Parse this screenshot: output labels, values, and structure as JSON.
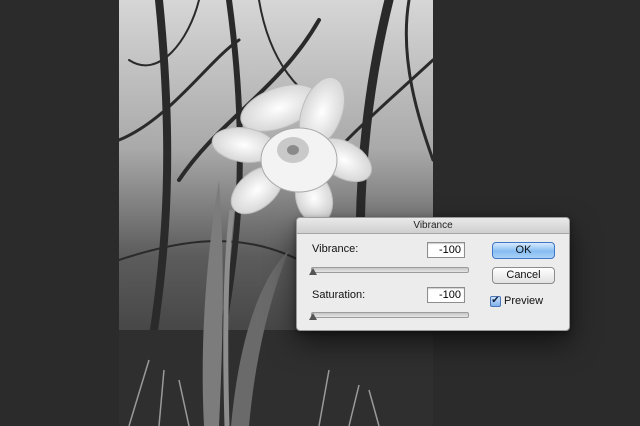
{
  "dialog": {
    "title": "Vibrance",
    "vibrance": {
      "label": "Vibrance:",
      "value": "-100",
      "slider_fraction": 0.0
    },
    "saturation": {
      "label": "Saturation:",
      "value": "-100",
      "slider_fraction": 0.0
    },
    "ok_label": "OK",
    "cancel_label": "Cancel",
    "preview": {
      "label": "Preview",
      "checked": true
    }
  },
  "colors": {
    "workspace_bg": "#2b2b2b",
    "dialog_bg": "#ececec",
    "ok_accent": "#86bdf2"
  },
  "canvas": {
    "image_subject": "black-and-white daffodil photo"
  }
}
